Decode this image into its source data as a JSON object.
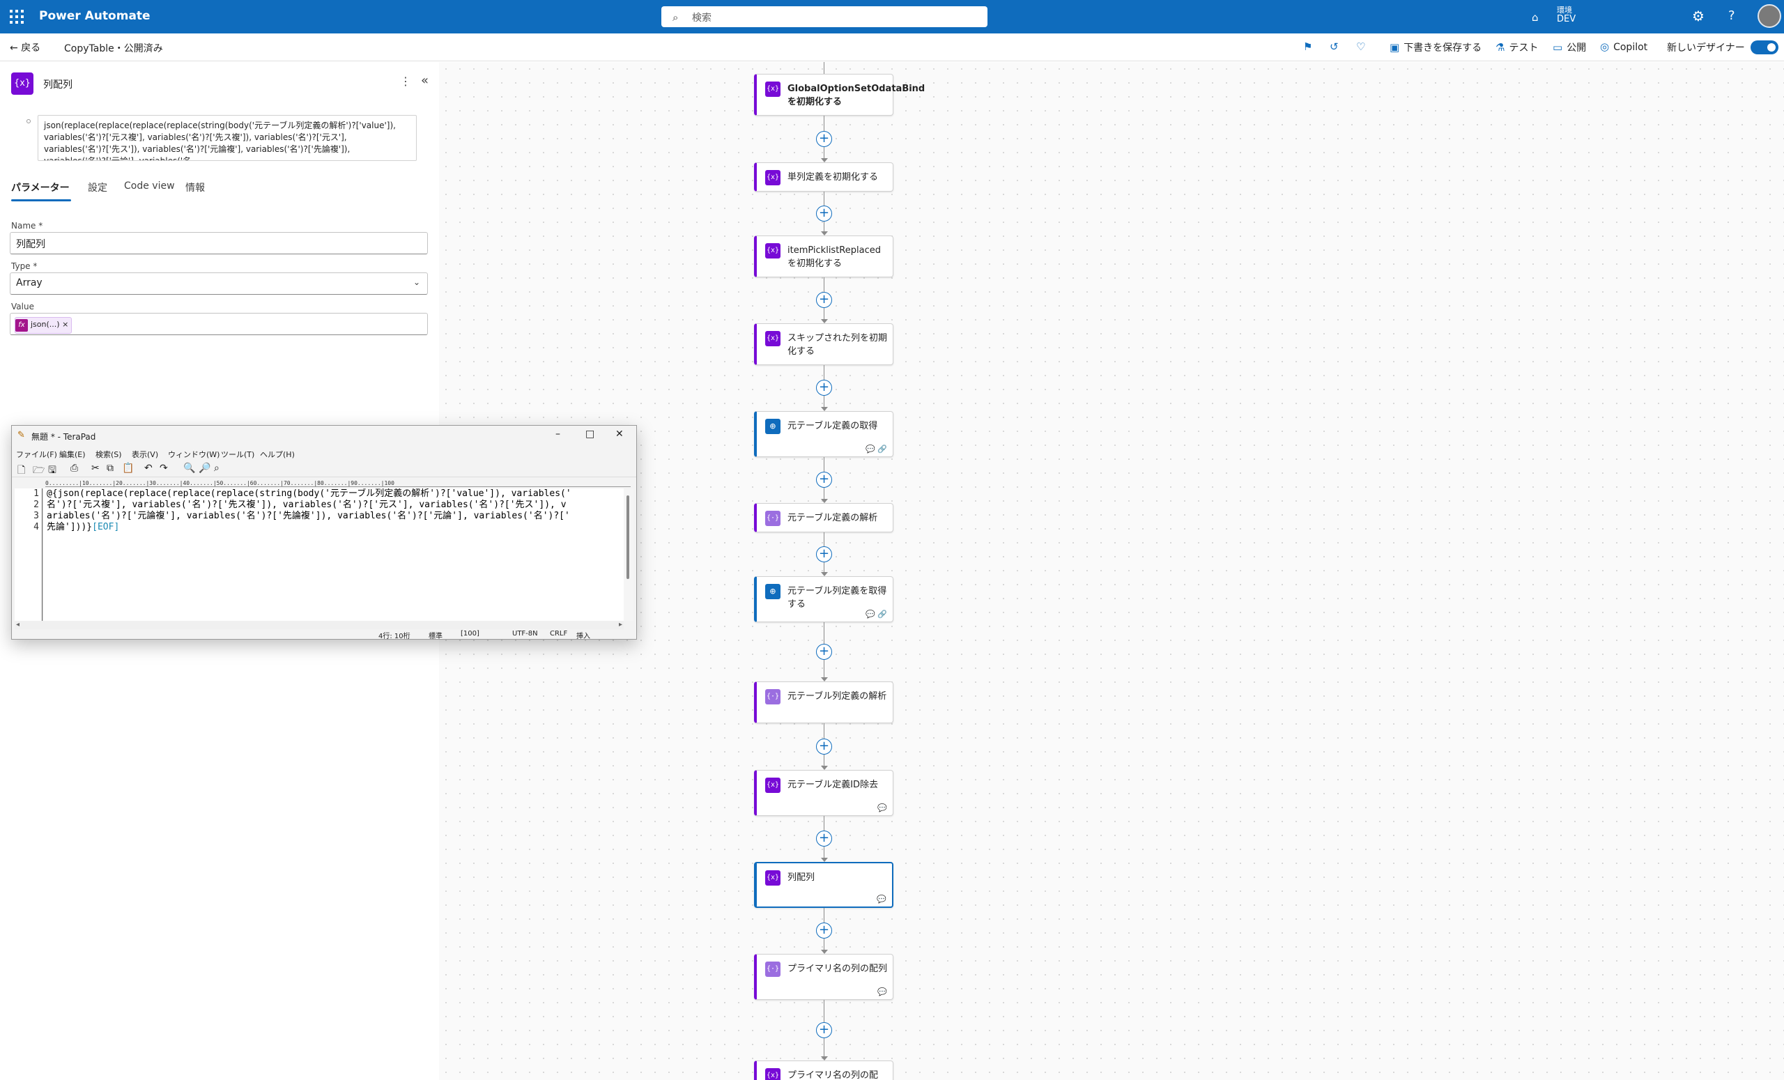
{
  "topbar": {
    "app_name": "Power Automate",
    "search_placeholder": "検索",
    "env_label": "環境",
    "env_value": "DEV"
  },
  "cmdbar": {
    "back_label": "戻る",
    "flow_name": "CopyTable・公開済み",
    "save_draft": "下書きを保存する",
    "test": "テスト",
    "publish": "公開",
    "copilot": "Copilot",
    "new_designer": "新しいデザイナー"
  },
  "panel": {
    "icon": "{x}",
    "title": "列配列",
    "expression_preview": "json(replace(replace(replace(replace(string(body('元テーブル列定義の解析')?['value']), variables('名')?['元ス複'], variables('名')?['先ス複']), variables('名')?['元ス'], variables('名')?['先ス']), variables('名')?['元論複'], variables('名')?['先論複']), variables('名')?['元論'], variables('名",
    "tabs": [
      "パラメーター",
      "設定",
      "Code view",
      "情報"
    ],
    "name_label": "Name *",
    "name_value": "列配列",
    "type_label": "Type *",
    "type_value": "Array",
    "value_label": "Value",
    "value_token": "json(...)",
    "value_token_close": "×",
    "value_token_icon": "fx"
  },
  "terapad": {
    "title": "無題 * - TeraPad",
    "menu": [
      "ファイル(F)",
      "編集(E)",
      "検索(S)",
      "表示(V)",
      "ウィンドウ(W)",
      "ツール(T)",
      "ヘルプ(H)"
    ],
    "ruler": "0.........|10.......|20.......|30.......|40.......|50.......|60.......|70.......|80.......|90.......|100",
    "line_numbers": "1\n2\n3\n4",
    "lines": [
      "@{json(replace(replace(replace(replace(string(body('元テーブル列定義の解析')?['value']), variables('",
      "名')?['元ス複'], variables('名')?['先ス複']), variables('名')?['元ス'], variables('名')?['先ス']), v",
      "ariables('名')?['元論複'], variables('名')?['先論複']), variables('名')?['元論'], variables('名')?['",
      "先論']))}"
    ],
    "eof": "[EOF]",
    "status": {
      "position": "4行: 10桁",
      "mode": "標準",
      "zoom": "[100]",
      "encoding": "UTF-8N",
      "newline": "CRLF",
      "insert": "挿入"
    }
  },
  "flow": {
    "cards": [
      {
        "title": "GlobalOptionSetOdataBindを初期化する",
        "kind": "variable",
        "bold": true,
        "icon": "{x}"
      },
      {
        "title": "単列定義を初期化する",
        "kind": "variable",
        "bold": false,
        "icon": "{x}"
      },
      {
        "title": "itemPicklistReplacedを初期化する",
        "kind": "variable",
        "bold": false,
        "icon": "{x}"
      },
      {
        "title": "スキップされた列を初期化する",
        "kind": "variable",
        "bold": false,
        "icon": "{x}"
      },
      {
        "title": "元テーブル定義の取得",
        "kind": "http",
        "bold": false,
        "icon": "globe"
      },
      {
        "title": "元テーブル定義の解析",
        "kind": "parse",
        "bold": false,
        "icon": "{·}"
      },
      {
        "title": "元テーブル列定義を取得する",
        "kind": "http",
        "bold": false,
        "icon": "globe"
      },
      {
        "title": "元テーブル列定義の解析",
        "kind": "parse",
        "bold": false,
        "icon": "{·}"
      },
      {
        "title": "元テーブル定義ID除去",
        "kind": "variable",
        "bold": false,
        "icon": "{x}"
      },
      {
        "title": "列配列",
        "kind": "variable",
        "bold": false,
        "icon": "{x}",
        "selected": true
      },
      {
        "title": "プライマリ名の列の配列",
        "kind": "parse",
        "bold": false,
        "icon": "{·}"
      },
      {
        "title": "プライマリ名の列の配",
        "kind": "variable",
        "bold": false,
        "icon": "{x}"
      }
    ]
  }
}
